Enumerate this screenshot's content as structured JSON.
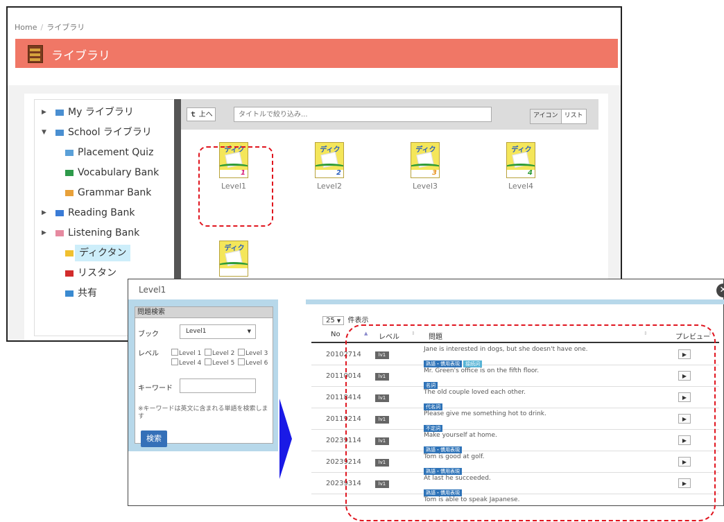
{
  "library": {
    "breadcrumb": [
      "Home",
      "ライブラリ"
    ],
    "title": "ライブラリ",
    "tree": [
      {
        "label": "My ライブラリ",
        "expander": "▶",
        "color": "#4a8fd1"
      },
      {
        "label": "School ライブラリ",
        "expander": "▼",
        "color": "#4a8fd1"
      },
      {
        "label": "Placement Quiz",
        "color": "#5aa0d8"
      },
      {
        "label": "Vocabulary Bank",
        "color": "#2e9a4a"
      },
      {
        "label": "Grammar Bank",
        "color": "#e8a13a"
      },
      {
        "label": "Reading Bank",
        "expander": "▶",
        "color": "#3a7bd6"
      },
      {
        "label": "Listening Bank",
        "expander": "▶",
        "color": "#e68aa0"
      },
      {
        "label": "ディクタン",
        "color": "#f0c030"
      },
      {
        "label": "リスタン",
        "color": "#d22c2c"
      },
      {
        "label": "共有",
        "color": "#3a8ad0"
      }
    ],
    "up_button": "上へ",
    "filter_placeholder": "タイトルで絞り込み...",
    "view_buttons": [
      "アイコン",
      "リスト"
    ],
    "books": [
      {
        "caption": "Level1",
        "cover_title": "ディクタン",
        "level_num": "1",
        "num_color": "#d8207a"
      },
      {
        "caption": "Level2",
        "cover_title": "ディクタン",
        "level_num": "2",
        "num_color": "#2a5fbd"
      },
      {
        "caption": "Level3",
        "cover_title": "ディクタン",
        "level_num": "3",
        "num_color": "#e89420"
      },
      {
        "caption": "Level4",
        "cover_title": "ディクタン",
        "level_num": "4",
        "num_color": "#2f9c36"
      },
      {
        "caption": "",
        "cover_title": "ディクタン",
        "level_num": "",
        "num_color": "#d8207a"
      }
    ]
  },
  "dialog": {
    "title": "Level1",
    "close": "✕",
    "search": {
      "header": "問題検索",
      "book_label": "ブック",
      "book_value": "Level1",
      "level_label": "レベル",
      "levels": [
        "Level 1",
        "Level 2",
        "Level 3",
        "Level 4",
        "Level 5",
        "Level 6"
      ],
      "keyword_label": "キーワード",
      "note": "※キーワードは英文に含まれる単語を検索します",
      "button": "検索"
    },
    "per_page": {
      "value": "25",
      "suffix": "件表示"
    },
    "columns": {
      "no": "No",
      "level": "レベル",
      "question": "問題",
      "preview": "プレビュー"
    },
    "rows": [
      {
        "no": "20102714",
        "level": "lv1",
        "question": "Jane is interested in dogs, but she doesn't have one.",
        "tags": [
          "熟語・慣用表現",
          "接続詞"
        ]
      },
      {
        "no": "20110014",
        "level": "lv1",
        "question": "Mr. Green's office is on the fifth floor.",
        "tags": [
          "名詞"
        ]
      },
      {
        "no": "20118414",
        "level": "lv1",
        "question": "The old couple loved each other.",
        "tags": [
          "代名詞"
        ]
      },
      {
        "no": "20119214",
        "level": "lv1",
        "question": "Please give me something hot to drink.",
        "tags": [
          "不定詞"
        ]
      },
      {
        "no": "20239114",
        "level": "lv1",
        "question": "Make yourself at home.",
        "tags": [
          "熟語・慣用表現"
        ]
      },
      {
        "no": "20239214",
        "level": "lv1",
        "question": "Tom is good at golf.",
        "tags": [
          "熟語・慣用表現"
        ]
      },
      {
        "no": "20239314",
        "level": "lv1",
        "question": "At last he succeeded.",
        "tags": [
          "熟語・慣用表現"
        ]
      },
      {
        "no": "",
        "level": "",
        "question": "Tom is able to speak Japanese.",
        "tags": []
      }
    ]
  },
  "colors": {
    "header": "#f07766",
    "highlight": "#e0141e",
    "primary": "#3570b8",
    "arrow": "#1a1ae6"
  }
}
